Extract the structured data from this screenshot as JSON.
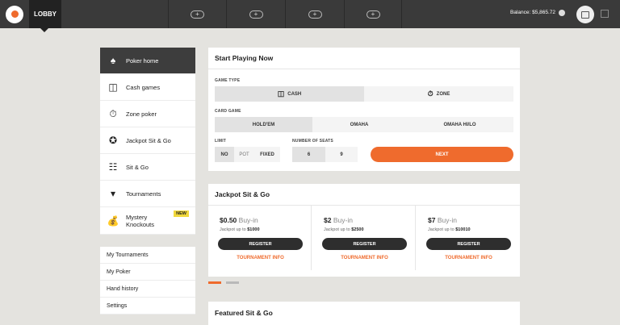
{
  "topbar": {
    "lobby_label": "LOBBY",
    "slots": [
      "+",
      "+",
      "+",
      "+"
    ],
    "balance": "Balance: $5,865.72"
  },
  "sidebar": {
    "items": [
      {
        "label": "Poker home",
        "icon": "cards-icon"
      },
      {
        "label": "Cash games",
        "icon": "chips-icon"
      },
      {
        "label": "Zone poker",
        "icon": "stopwatch-icon"
      },
      {
        "label": "Jackpot Sit & Go",
        "icon": "jackpot-chip-icon"
      },
      {
        "label": "Sit & Go",
        "icon": "chip-stack-icon"
      },
      {
        "label": "Tournaments",
        "icon": "trophy-icon"
      },
      {
        "label_line1": "Mystery",
        "label_line2": "Knockouts",
        "icon": "money-bag-icon",
        "badge": "NEW"
      }
    ],
    "links": [
      "My Tournaments",
      "My Poker",
      "Hand history",
      "Settings"
    ]
  },
  "start": {
    "title": "Start Playing Now",
    "game_type_label": "GAME TYPE",
    "game_types": [
      "CASH",
      "ZONE"
    ],
    "card_game_label": "CARD GAME",
    "card_games": [
      "HOLD'EM",
      "OMAHA",
      "OMAHA HI/LO"
    ],
    "limit_label": "LIMIT",
    "limits": [
      "NO",
      "POT",
      "FIXED"
    ],
    "seats_label": "NUMBER OF SEATS",
    "seats": [
      "6",
      "9"
    ],
    "next_label": "NEXT"
  },
  "jackpot": {
    "title": "Jackpot Sit & Go",
    "buyin_label": "Buy-in",
    "jackpot_prefix": "Jackpot up to",
    "register_label": "REGISTER",
    "info_label": "TOURNAMENT INFO",
    "cards": [
      {
        "price": "$0.50",
        "jackpot": "$1000"
      },
      {
        "price": "$2",
        "jackpot": "$2500"
      },
      {
        "price": "$7",
        "jackpot": "$10010"
      }
    ]
  },
  "featured": {
    "title": "Featured Sit & Go"
  },
  "colors": {
    "accent": "#ef6b2d",
    "topbar": "#3a3a3a",
    "background": "#e4e3df"
  }
}
